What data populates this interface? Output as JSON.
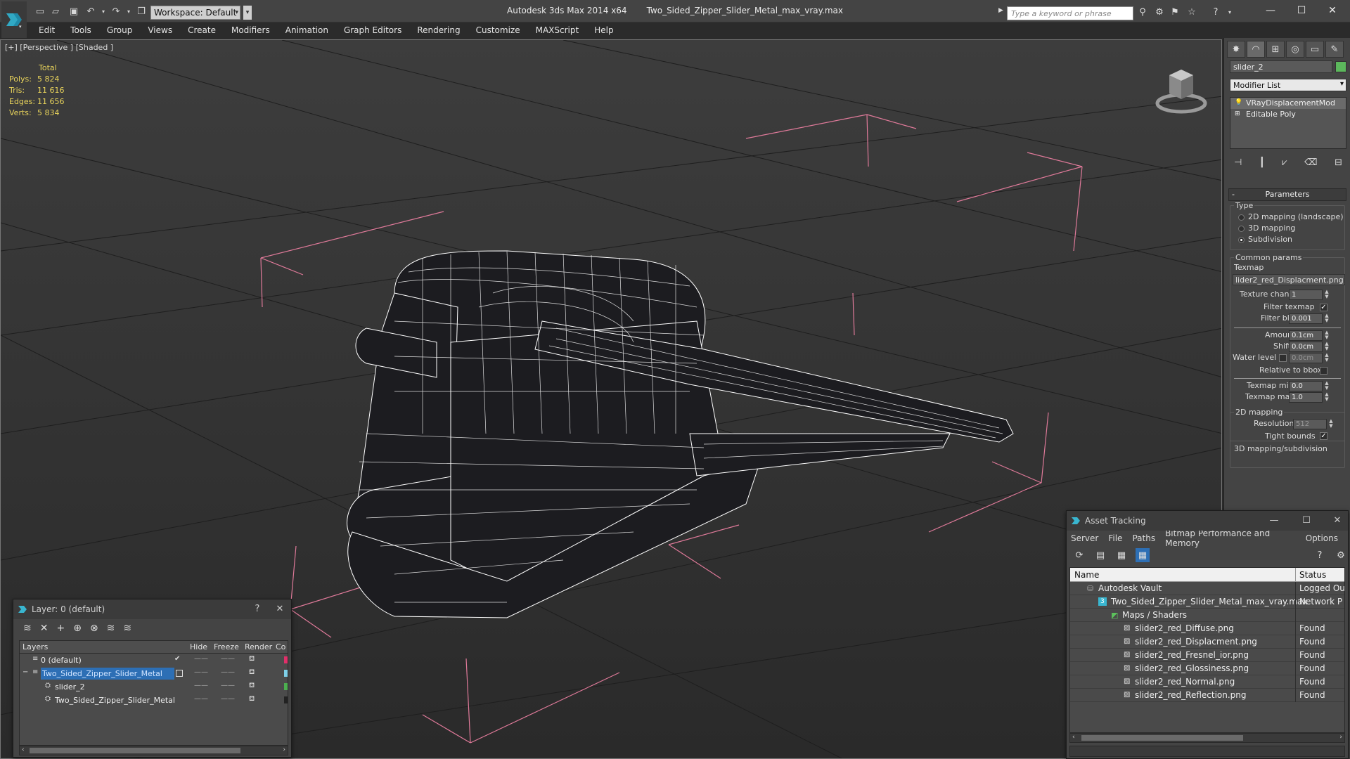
{
  "titlebar": {
    "app_title": "Autodesk 3ds Max  2014 x64",
    "file_name": "Two_Sided_Zipper_Slider_Metal_max_vray.max",
    "workspace": "Workspace: Default",
    "search_placeholder": "Type a keyword or phrase",
    "minimize": "—",
    "maximize": "☐",
    "close": "✕"
  },
  "menu": [
    "Edit",
    "Tools",
    "Group",
    "Views",
    "Create",
    "Modifiers",
    "Animation",
    "Graph Editors",
    "Rendering",
    "Customize",
    "MAXScript",
    "Help"
  ],
  "viewport": {
    "label": "[+] [Perspective ] [Shaded ]",
    "stats_header": "Total",
    "stats": [
      {
        "label": "Polys:",
        "value": "5 824"
      },
      {
        "label": "Tris:",
        "value": "11 616"
      },
      {
        "label": "Edges:",
        "value": "11 656"
      },
      {
        "label": "Verts:",
        "value": "5 834"
      }
    ],
    "wire_color": "#ffffff",
    "bracket_color": "#e07a9a"
  },
  "command_panel": {
    "object_name": "slider_2",
    "object_color": "#5cb85c",
    "modifier_list": "Modifier List",
    "stack": [
      "VRayDisplacementMod",
      "Editable Poly"
    ],
    "rollout_title": "Parameters",
    "type_label": "Type",
    "type_options": [
      "2D mapping (landscape)",
      "3D mapping",
      "Subdivision"
    ],
    "selected_type": 2,
    "common_params": "Common params",
    "texmap_label": "Texmap",
    "texmap_value": "lider2_red_Displacment.png)",
    "texture_chan_label": "Texture chan",
    "texture_chan": "1",
    "filter_texmap": "Filter texmap",
    "filter_blur_label": "Filter blur",
    "filter_blur": "0.001",
    "amount_label": "Amount",
    "amount": "0.1cm",
    "shift_label": "Shift",
    "shift": "0.0cm",
    "water_level_label": "Water level",
    "water_level": "0.0cm",
    "relative_bbox": "Relative to bbox",
    "texmap_min_label": "Texmap min",
    "texmap_min": "0.0",
    "texmap_max_label": "Texmap max",
    "texmap_max": "1.0",
    "mapping_2d": "2D mapping",
    "resolution_label": "Resolution",
    "resolution": "512",
    "tight_bounds": "Tight bounds",
    "mapping_3d": "3D mapping/subdivision"
  },
  "layer_window": {
    "title": "Layer: 0 (default)",
    "help": "?",
    "close": "✕",
    "columns": [
      "Layers",
      "Hide",
      "Freeze",
      "Render",
      "Co"
    ],
    "rows": [
      {
        "name": "0 (default)",
        "indent": 0,
        "color": "#e0306a"
      },
      {
        "name": "Two_Sided_Zipper_Slider_Metal",
        "indent": 0,
        "color": "#7fd0e8"
      },
      {
        "name": "slider_2",
        "indent": 1,
        "color": "#4caf50"
      },
      {
        "name": "Two_Sided_Zipper_Slider_Metal",
        "indent": 1,
        "color": "#222222"
      }
    ],
    "dash": "——"
  },
  "asset_window": {
    "title": "Asset Tracking",
    "menu": [
      "Server",
      "File",
      "Paths",
      "Bitmap Performance and Memory",
      "Options"
    ],
    "col_name": "Name",
    "col_status": "Status",
    "rows": [
      {
        "name": "Autodesk Vault",
        "indent": 0,
        "status": "Logged Ou"
      },
      {
        "name": "Two_Sided_Zipper_Slider_Metal_max_vray.max",
        "indent": 1,
        "status": "Network P"
      },
      {
        "name": "Maps / Shaders",
        "indent": 2,
        "status": ""
      },
      {
        "name": "slider2_red_Diffuse.png",
        "indent": 3,
        "status": "Found"
      },
      {
        "name": "slider2_red_Displacment.png",
        "indent": 3,
        "status": "Found"
      },
      {
        "name": "slider2_red_Fresnel_ior.png",
        "indent": 3,
        "status": "Found"
      },
      {
        "name": "slider2_red_Glossiness.png",
        "indent": 3,
        "status": "Found"
      },
      {
        "name": "slider2_red_Normal.png",
        "indent": 3,
        "status": "Found"
      },
      {
        "name": "slider2_red_Reflection.png",
        "indent": 3,
        "status": "Found"
      }
    ],
    "minimize": "—",
    "maximize": "☐",
    "close": "✕"
  }
}
